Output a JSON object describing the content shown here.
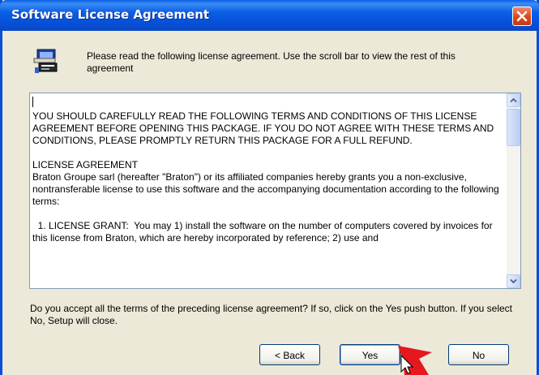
{
  "window": {
    "title": "Software License Agreement"
  },
  "icons": {
    "close": "close-icon",
    "header": "setup-computer-icon",
    "scroll_up": "scroll-up-arrow-icon",
    "scroll_down": "scroll-down-arrow-icon"
  },
  "header": {
    "instruction": "Please read the following license agreement. Use the scroll bar to view the rest of this agreement"
  },
  "license": {
    "paragraph_1": "YOU SHOULD CAREFULLY READ THE FOLLOWING TERMS AND CONDITIONS OF THIS LICENSE AGREEMENT BEFORE OPENING THIS PACKAGE.  IF YOU DO NOT AGREE WITH THESE TERMS AND CONDITIONS, PLEASE PROMPTLY RETURN THIS PACKAGE FOR A FULL REFUND.",
    "heading": "LICENSE AGREEMENT",
    "paragraph_2": "Braton Groupe sarl (hereafter \"Braton\") or its affiliated companies hereby grants you a non-exclusive, nontransferable license to use this software and the accompanying documentation according to the following terms:",
    "paragraph_3": "  1. LICENSE GRANT:  You may 1) install the software on the number of computers covered by invoices for this license from Braton, which are hereby incorporated by reference; 2) use and"
  },
  "prompt": {
    "question": "Do you accept all the terms of the preceding license agreement?  If so, click on the Yes push button. If you select No, Setup will close."
  },
  "buttons": {
    "back": "< Back",
    "yes": "Yes",
    "no": "No"
  },
  "colors": {
    "titlebar": "#0650d8",
    "dialog_bg": "#ece9d8",
    "close_button": "#d8471d",
    "annotation_arrow": "#e4181e"
  }
}
